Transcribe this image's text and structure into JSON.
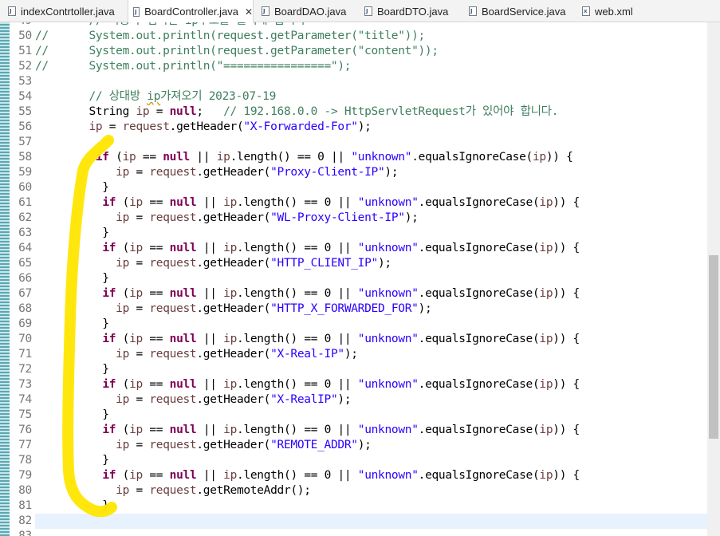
{
  "tabs": [
    {
      "label": "indexContrtoller.java",
      "kind": "java",
      "active": false
    },
    {
      "label": "BoardController.java",
      "kind": "java",
      "active": true
    },
    {
      "label": "BoardDAO.java",
      "kind": "java",
      "active": false
    },
    {
      "label": "BoardDTO.java",
      "kind": "java",
      "active": false
    },
    {
      "label": "BoardService.java",
      "kind": "java",
      "active": false
    },
    {
      "label": "web.xml",
      "kind": "xml",
      "active": false
    }
  ],
  "editor": {
    "current_line": 82,
    "lines": [
      {
        "n": "49",
        "segments": [
          {
            "t": "        // 사용자 접속한 ip주소를 출력해 봅시다",
            "c": "com"
          }
        ]
      },
      {
        "n": "50",
        "segments": [
          {
            "t": "//      System.out.println(request.getParameter(\"title\"));",
            "c": "com"
          }
        ]
      },
      {
        "n": "51",
        "segments": [
          {
            "t": "//      System.out.println(request.getParameter(\"content\"));",
            "c": "com"
          }
        ]
      },
      {
        "n": "52",
        "segments": [
          {
            "t": "//      System.out.println(\"================\");",
            "c": "com"
          }
        ]
      },
      {
        "n": "53",
        "segments": [
          {
            "t": "",
            "c": ""
          }
        ]
      },
      {
        "n": "54",
        "segments": [
          {
            "t": "        // 상대방 ",
            "c": "com"
          },
          {
            "t": "ip",
            "c": "com sq"
          },
          {
            "t": "가져오기 2023-07-19",
            "c": "com"
          }
        ]
      },
      {
        "n": "55",
        "segments": [
          {
            "t": "        String ",
            "c": ""
          },
          {
            "t": "ip",
            "c": "var"
          },
          {
            "t": " = ",
            "c": ""
          },
          {
            "t": "null",
            "c": "kw"
          },
          {
            "t": ";   ",
            "c": ""
          },
          {
            "t": "// 192.168.0.0 -> HttpServletRequest가 있어야 합니다.",
            "c": "com"
          }
        ]
      },
      {
        "n": "56",
        "segments": [
          {
            "t": "        ",
            "c": ""
          },
          {
            "t": "ip",
            "c": "var"
          },
          {
            "t": " = ",
            "c": ""
          },
          {
            "t": "request",
            "c": "var"
          },
          {
            "t": ".getHeader(",
            "c": ""
          },
          {
            "t": "\"X-Forwarded-For\"",
            "c": "str"
          },
          {
            "t": ");",
            "c": ""
          }
        ]
      },
      {
        "n": "57",
        "segments": [
          {
            "t": "",
            "c": ""
          }
        ]
      },
      {
        "n": "58",
        "segments": [
          {
            "t": "         ",
            "c": ""
          },
          {
            "t": "if",
            "c": "kw"
          },
          {
            "t": " (",
            "c": ""
          },
          {
            "t": "ip",
            "c": "var"
          },
          {
            "t": " == ",
            "c": ""
          },
          {
            "t": "null",
            "c": "kw"
          },
          {
            "t": " || ",
            "c": ""
          },
          {
            "t": "ip",
            "c": "var"
          },
          {
            "t": ".length() == 0 || ",
            "c": ""
          },
          {
            "t": "\"unknown\"",
            "c": "str"
          },
          {
            "t": ".equalsIgnoreCase(",
            "c": ""
          },
          {
            "t": "ip",
            "c": "var"
          },
          {
            "t": ")) {",
            "c": ""
          }
        ]
      },
      {
        "n": "59",
        "segments": [
          {
            "t": "            ",
            "c": ""
          },
          {
            "t": "ip",
            "c": "var"
          },
          {
            "t": " = ",
            "c": ""
          },
          {
            "t": "request",
            "c": "var"
          },
          {
            "t": ".getHeader(",
            "c": ""
          },
          {
            "t": "\"Proxy-Client-IP\"",
            "c": "str"
          },
          {
            "t": ");",
            "c": ""
          }
        ]
      },
      {
        "n": "60",
        "segments": [
          {
            "t": "          }",
            "c": ""
          }
        ]
      },
      {
        "n": "61",
        "segments": [
          {
            "t": "          ",
            "c": ""
          },
          {
            "t": "if",
            "c": "kw"
          },
          {
            "t": " (",
            "c": ""
          },
          {
            "t": "ip",
            "c": "var"
          },
          {
            "t": " == ",
            "c": ""
          },
          {
            "t": "null",
            "c": "kw"
          },
          {
            "t": " || ",
            "c": ""
          },
          {
            "t": "ip",
            "c": "var"
          },
          {
            "t": ".length() == 0 || ",
            "c": ""
          },
          {
            "t": "\"unknown\"",
            "c": "str"
          },
          {
            "t": ".equalsIgnoreCase(",
            "c": ""
          },
          {
            "t": "ip",
            "c": "var"
          },
          {
            "t": ")) {",
            "c": ""
          }
        ]
      },
      {
        "n": "62",
        "segments": [
          {
            "t": "            ",
            "c": ""
          },
          {
            "t": "ip",
            "c": "var"
          },
          {
            "t": " = ",
            "c": ""
          },
          {
            "t": "request",
            "c": "var"
          },
          {
            "t": ".getHeader(",
            "c": ""
          },
          {
            "t": "\"WL-Proxy-Client-IP\"",
            "c": "str"
          },
          {
            "t": ");",
            "c": ""
          }
        ]
      },
      {
        "n": "63",
        "segments": [
          {
            "t": "          }",
            "c": ""
          }
        ]
      },
      {
        "n": "64",
        "segments": [
          {
            "t": "          ",
            "c": ""
          },
          {
            "t": "if",
            "c": "kw"
          },
          {
            "t": " (",
            "c": ""
          },
          {
            "t": "ip",
            "c": "var"
          },
          {
            "t": " == ",
            "c": ""
          },
          {
            "t": "null",
            "c": "kw"
          },
          {
            "t": " || ",
            "c": ""
          },
          {
            "t": "ip",
            "c": "var"
          },
          {
            "t": ".length() == 0 || ",
            "c": ""
          },
          {
            "t": "\"unknown\"",
            "c": "str"
          },
          {
            "t": ".equalsIgnoreCase(",
            "c": ""
          },
          {
            "t": "ip",
            "c": "var"
          },
          {
            "t": ")) {",
            "c": ""
          }
        ]
      },
      {
        "n": "65",
        "segments": [
          {
            "t": "            ",
            "c": ""
          },
          {
            "t": "ip",
            "c": "var"
          },
          {
            "t": " = ",
            "c": ""
          },
          {
            "t": "request",
            "c": "var"
          },
          {
            "t": ".getHeader(",
            "c": ""
          },
          {
            "t": "\"HTTP_CLIENT_IP\"",
            "c": "str"
          },
          {
            "t": ");",
            "c": ""
          }
        ]
      },
      {
        "n": "66",
        "segments": [
          {
            "t": "          }",
            "c": ""
          }
        ]
      },
      {
        "n": "67",
        "segments": [
          {
            "t": "          ",
            "c": ""
          },
          {
            "t": "if",
            "c": "kw"
          },
          {
            "t": " (",
            "c": ""
          },
          {
            "t": "ip",
            "c": "var"
          },
          {
            "t": " == ",
            "c": ""
          },
          {
            "t": "null",
            "c": "kw"
          },
          {
            "t": " || ",
            "c": ""
          },
          {
            "t": "ip",
            "c": "var"
          },
          {
            "t": ".length() == 0 || ",
            "c": ""
          },
          {
            "t": "\"unknown\"",
            "c": "str"
          },
          {
            "t": ".equalsIgnoreCase(",
            "c": ""
          },
          {
            "t": "ip",
            "c": "var"
          },
          {
            "t": ")) {",
            "c": ""
          }
        ]
      },
      {
        "n": "68",
        "segments": [
          {
            "t": "            ",
            "c": ""
          },
          {
            "t": "ip",
            "c": "var"
          },
          {
            "t": " = ",
            "c": ""
          },
          {
            "t": "request",
            "c": "var"
          },
          {
            "t": ".getHeader(",
            "c": ""
          },
          {
            "t": "\"HTTP_X_FORWARDED_FOR\"",
            "c": "str"
          },
          {
            "t": ");",
            "c": ""
          }
        ]
      },
      {
        "n": "69",
        "segments": [
          {
            "t": "          }",
            "c": ""
          }
        ]
      },
      {
        "n": "70",
        "segments": [
          {
            "t": "          ",
            "c": ""
          },
          {
            "t": "if",
            "c": "kw"
          },
          {
            "t": " (",
            "c": ""
          },
          {
            "t": "ip",
            "c": "var"
          },
          {
            "t": " == ",
            "c": ""
          },
          {
            "t": "null",
            "c": "kw"
          },
          {
            "t": " || ",
            "c": ""
          },
          {
            "t": "ip",
            "c": "var"
          },
          {
            "t": ".length() == 0 || ",
            "c": ""
          },
          {
            "t": "\"unknown\"",
            "c": "str"
          },
          {
            "t": ".equalsIgnoreCase(",
            "c": ""
          },
          {
            "t": "ip",
            "c": "var"
          },
          {
            "t": ")) {",
            "c": ""
          }
        ]
      },
      {
        "n": "71",
        "segments": [
          {
            "t": "            ",
            "c": ""
          },
          {
            "t": "ip",
            "c": "var"
          },
          {
            "t": " = ",
            "c": ""
          },
          {
            "t": "request",
            "c": "var"
          },
          {
            "t": ".getHeader(",
            "c": ""
          },
          {
            "t": "\"X-Real-IP\"",
            "c": "str"
          },
          {
            "t": ");",
            "c": ""
          }
        ]
      },
      {
        "n": "72",
        "segments": [
          {
            "t": "          }",
            "c": ""
          }
        ]
      },
      {
        "n": "73",
        "segments": [
          {
            "t": "          ",
            "c": ""
          },
          {
            "t": "if",
            "c": "kw"
          },
          {
            "t": " (",
            "c": ""
          },
          {
            "t": "ip",
            "c": "var"
          },
          {
            "t": " == ",
            "c": ""
          },
          {
            "t": "null",
            "c": "kw"
          },
          {
            "t": " || ",
            "c": ""
          },
          {
            "t": "ip",
            "c": "var"
          },
          {
            "t": ".length() == 0 || ",
            "c": ""
          },
          {
            "t": "\"unknown\"",
            "c": "str"
          },
          {
            "t": ".equalsIgnoreCase(",
            "c": ""
          },
          {
            "t": "ip",
            "c": "var"
          },
          {
            "t": ")) {",
            "c": ""
          }
        ]
      },
      {
        "n": "74",
        "segments": [
          {
            "t": "            ",
            "c": ""
          },
          {
            "t": "ip",
            "c": "var"
          },
          {
            "t": " = ",
            "c": ""
          },
          {
            "t": "request",
            "c": "var"
          },
          {
            "t": ".getHeader(",
            "c": ""
          },
          {
            "t": "\"X-RealIP\"",
            "c": "str"
          },
          {
            "t": ");",
            "c": ""
          }
        ]
      },
      {
        "n": "75",
        "segments": [
          {
            "t": "          }",
            "c": ""
          }
        ]
      },
      {
        "n": "76",
        "segments": [
          {
            "t": "          ",
            "c": ""
          },
          {
            "t": "if",
            "c": "kw"
          },
          {
            "t": " (",
            "c": ""
          },
          {
            "t": "ip",
            "c": "var"
          },
          {
            "t": " == ",
            "c": ""
          },
          {
            "t": "null",
            "c": "kw"
          },
          {
            "t": " || ",
            "c": ""
          },
          {
            "t": "ip",
            "c": "var"
          },
          {
            "t": ".length() == 0 || ",
            "c": ""
          },
          {
            "t": "\"unknown\"",
            "c": "str"
          },
          {
            "t": ".equalsIgnoreCase(",
            "c": ""
          },
          {
            "t": "ip",
            "c": "var"
          },
          {
            "t": ")) {",
            "c": ""
          }
        ]
      },
      {
        "n": "77",
        "segments": [
          {
            "t": "            ",
            "c": ""
          },
          {
            "t": "ip",
            "c": "var"
          },
          {
            "t": " = ",
            "c": ""
          },
          {
            "t": "request",
            "c": "var"
          },
          {
            "t": ".getHeader(",
            "c": ""
          },
          {
            "t": "\"REMOTE_ADDR\"",
            "c": "str"
          },
          {
            "t": ");",
            "c": ""
          }
        ]
      },
      {
        "n": "78",
        "segments": [
          {
            "t": "          }",
            "c": ""
          }
        ]
      },
      {
        "n": "79",
        "segments": [
          {
            "t": "          ",
            "c": ""
          },
          {
            "t": "if",
            "c": "kw"
          },
          {
            "t": " (",
            "c": ""
          },
          {
            "t": "ip",
            "c": "var"
          },
          {
            "t": " == ",
            "c": ""
          },
          {
            "t": "null",
            "c": "kw"
          },
          {
            "t": " || ",
            "c": ""
          },
          {
            "t": "ip",
            "c": "var"
          },
          {
            "t": ".length() == 0 || ",
            "c": ""
          },
          {
            "t": "\"unknown\"",
            "c": "str"
          },
          {
            "t": ".equalsIgnoreCase(",
            "c": ""
          },
          {
            "t": "ip",
            "c": "var"
          },
          {
            "t": ")) {",
            "c": ""
          }
        ]
      },
      {
        "n": "80",
        "segments": [
          {
            "t": "            ",
            "c": ""
          },
          {
            "t": "ip",
            "c": "var"
          },
          {
            "t": " = ",
            "c": ""
          },
          {
            "t": "request",
            "c": "var"
          },
          {
            "t": ".getRemoteAddr();",
            "c": ""
          }
        ]
      },
      {
        "n": "81",
        "segments": [
          {
            "t": "          }",
            "c": ""
          }
        ]
      },
      {
        "n": "82",
        "segments": [
          {
            "t": "",
            "c": ""
          }
        ]
      },
      {
        "n": "83",
        "segments": [
          {
            "t": "",
            "c": ""
          }
        ]
      }
    ]
  },
  "colors": {
    "keyword": "#7f0055",
    "string": "#2a00ff",
    "comment": "#3f7f5f",
    "variable": "#6a3e3e",
    "current_line": "#e8f2fe",
    "highlighter": "#ffe600",
    "line_number": "#787878"
  }
}
